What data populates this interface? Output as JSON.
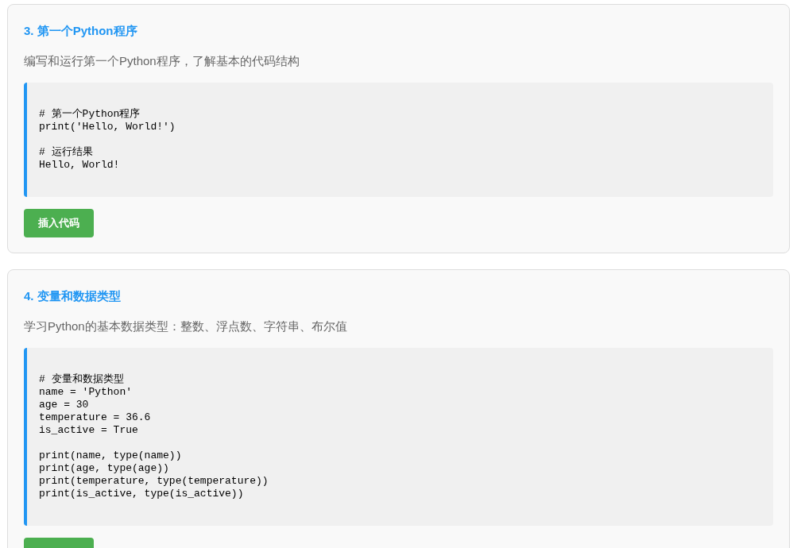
{
  "lessons": [
    {
      "title": "3. 第一个Python程序",
      "description": "编写和运行第一个Python程序，了解基本的代码结构",
      "code": "# 第一个Python程序\nprint('Hello, World!')\n\n# 运行结果\nHello, World!",
      "button": "插入代码"
    },
    {
      "title": "4. 变量和数据类型",
      "description": "学习Python的基本数据类型：整数、浮点数、字符串、布尔值",
      "code": "# 变量和数据类型\nname = 'Python'\nage = 30\ntemperature = 36.6\nis_active = True\n\nprint(name, type(name))\nprint(age, type(age))\nprint(temperature, type(temperature))\nprint(is_active, type(is_active))"
    }
  ]
}
